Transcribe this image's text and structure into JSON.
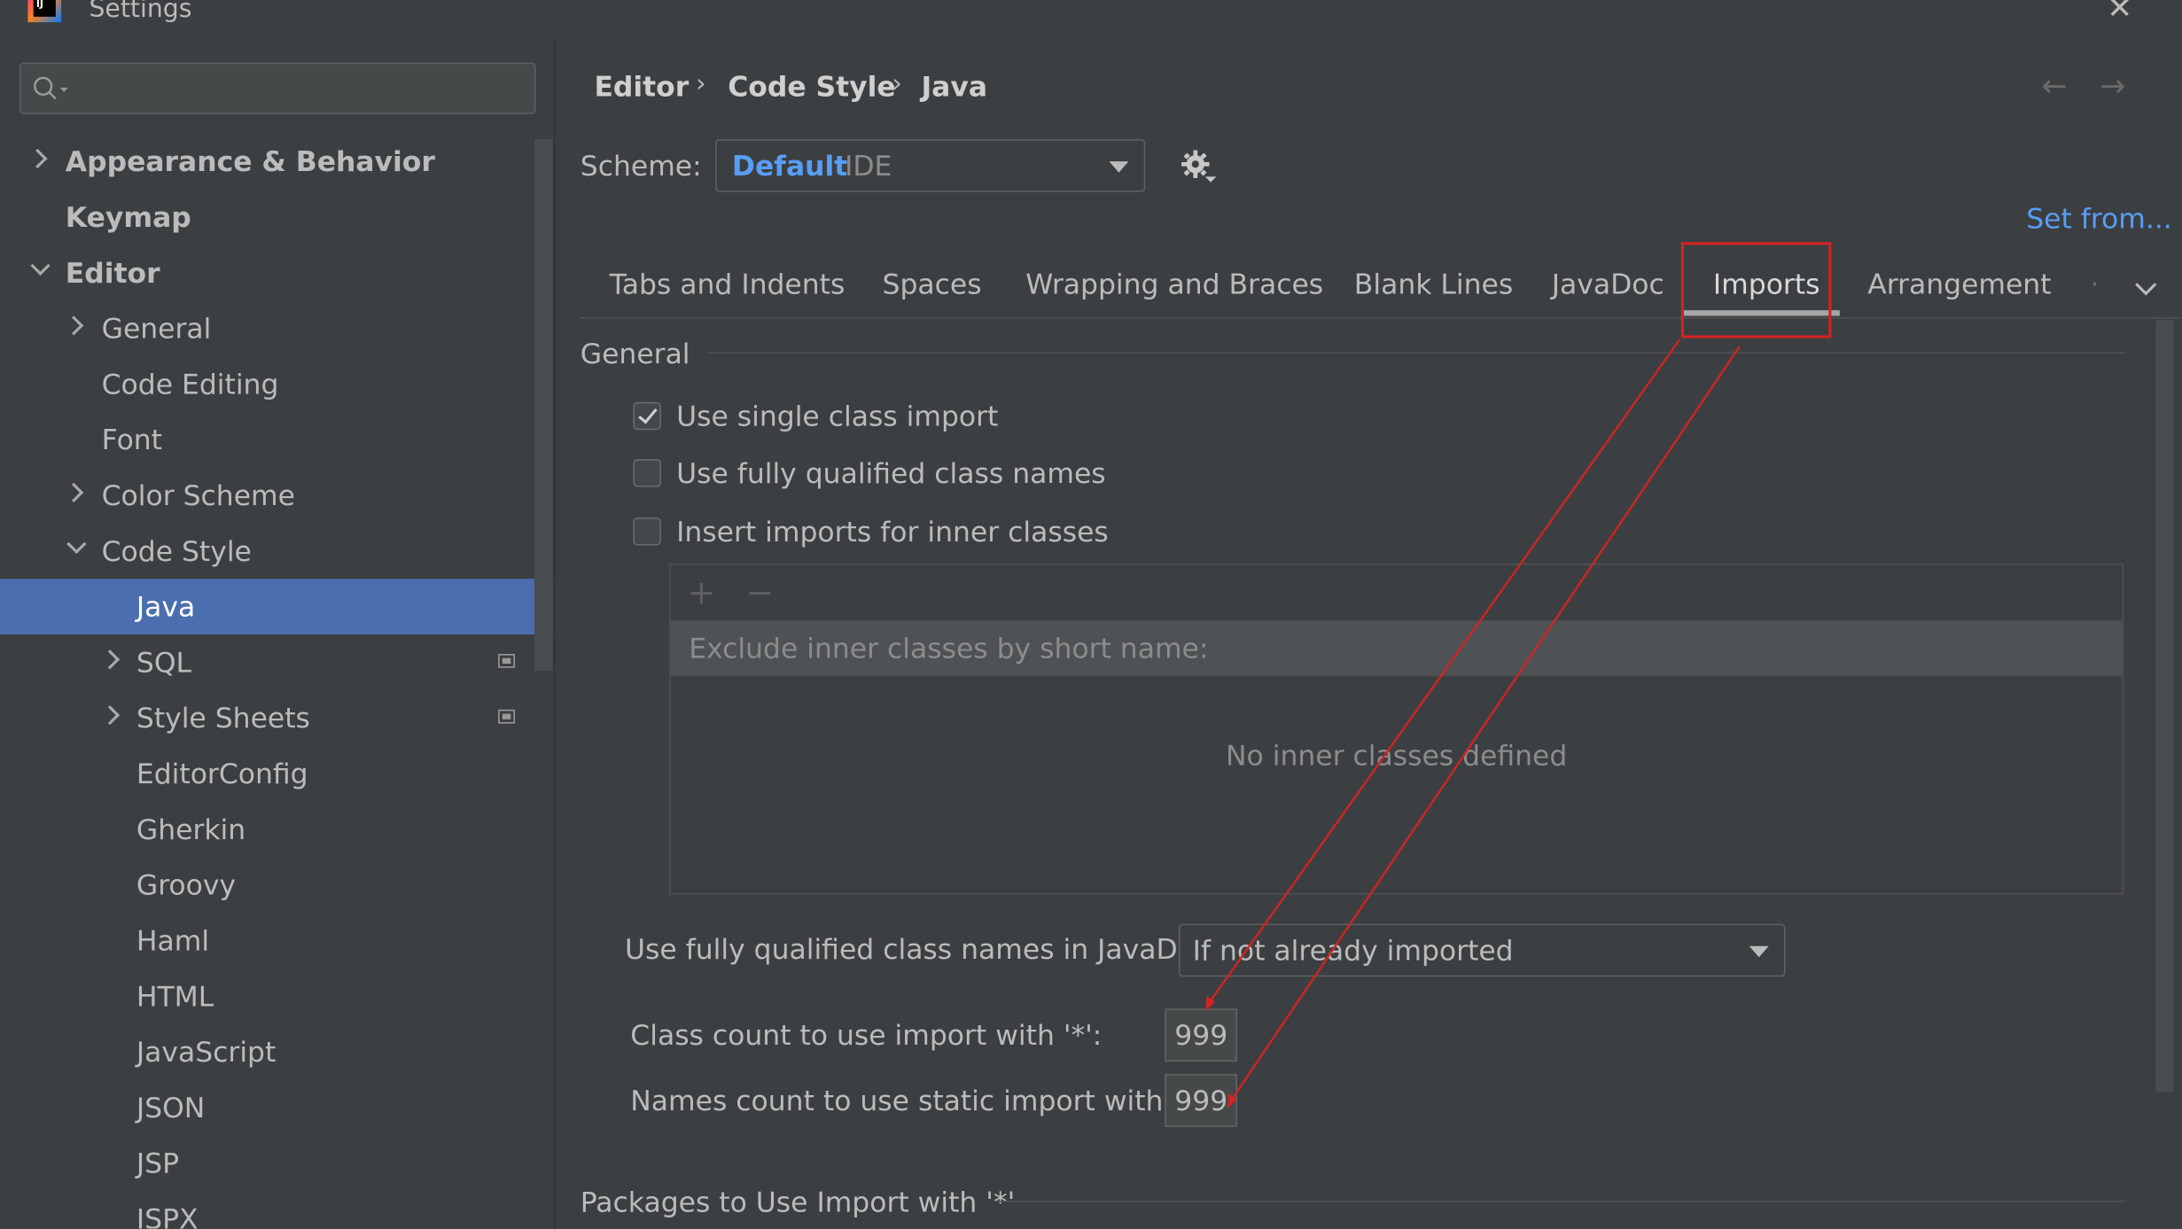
{
  "window": {
    "title": "Settings"
  },
  "search": {
    "value": ""
  },
  "sidebar": {
    "items": [
      {
        "label": "Appearance & Behavior"
      },
      {
        "label": "Keymap"
      },
      {
        "label": "Editor"
      },
      {
        "label": "General"
      },
      {
        "label": "Code Editing"
      },
      {
        "label": "Font"
      },
      {
        "label": "Color Scheme"
      },
      {
        "label": "Code Style"
      },
      {
        "label": "Java"
      },
      {
        "label": "SQL"
      },
      {
        "label": "Style Sheets"
      },
      {
        "label": "EditorConfig"
      },
      {
        "label": "Gherkin"
      },
      {
        "label": "Groovy"
      },
      {
        "label": "Haml"
      },
      {
        "label": "HTML"
      },
      {
        "label": "JavaScript"
      },
      {
        "label": "JSON"
      },
      {
        "label": "JSP"
      },
      {
        "label": "JSPX"
      }
    ]
  },
  "breadcrumb": [
    "Editor",
    "Code Style",
    "Java"
  ],
  "breadcrumb_sep": "›",
  "nav": {
    "back": "←",
    "forward": "→"
  },
  "scheme": {
    "label": "Scheme:",
    "name": "Default",
    "suffix": "IDE"
  },
  "set_from": "Set from...",
  "tabs": [
    "Tabs and Indents",
    "Spaces",
    "Wrapping and Braces",
    "Blank Lines",
    "JavaDoc",
    "Imports",
    "Arrangement",
    "·"
  ],
  "active_tab": "Imports",
  "general": {
    "title": "General",
    "options": [
      {
        "label": "Use single class import",
        "checked": true
      },
      {
        "label": "Use fully qualified class names",
        "checked": false
      },
      {
        "label": "Insert imports for inner classes",
        "checked": false
      }
    ],
    "add_button": "+",
    "remove_button": "−",
    "exclude_header": "Exclude inner classes by short name:",
    "empty_text": "No inner classes defined",
    "javadoc_label": "Use fully qualified class names in JavaDoc:",
    "javadoc_value": "If not already imported",
    "class_count_label": "Class count to use import with '*':",
    "class_count_value": "999",
    "names_count_label": "Names count to use static import with '*':",
    "names_count_value": "999"
  },
  "packages_title": "Packages to Use Import with '*'",
  "colors": {
    "accent": "#589df6",
    "selection": "#4b6eaf",
    "annotation": "#d32323"
  }
}
